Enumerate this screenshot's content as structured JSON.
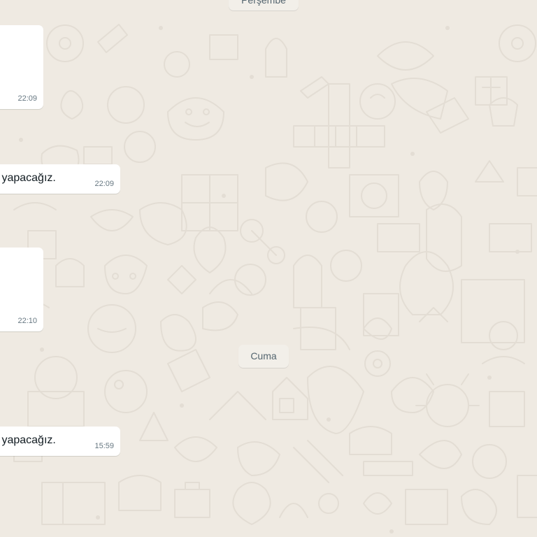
{
  "chat": {
    "background_color": "#efeae2",
    "date_separators": {
      "top": "Perşembe",
      "cuma": "Cuma"
    },
    "messages": [
      {
        "text": "",
        "time": "22:09"
      },
      {
        "text": "s yapacağız.",
        "time": "22:09"
      },
      {
        "text": "",
        "time": "22:10"
      },
      {
        "text": "s yapacağız.",
        "time": "15:59"
      }
    ]
  }
}
